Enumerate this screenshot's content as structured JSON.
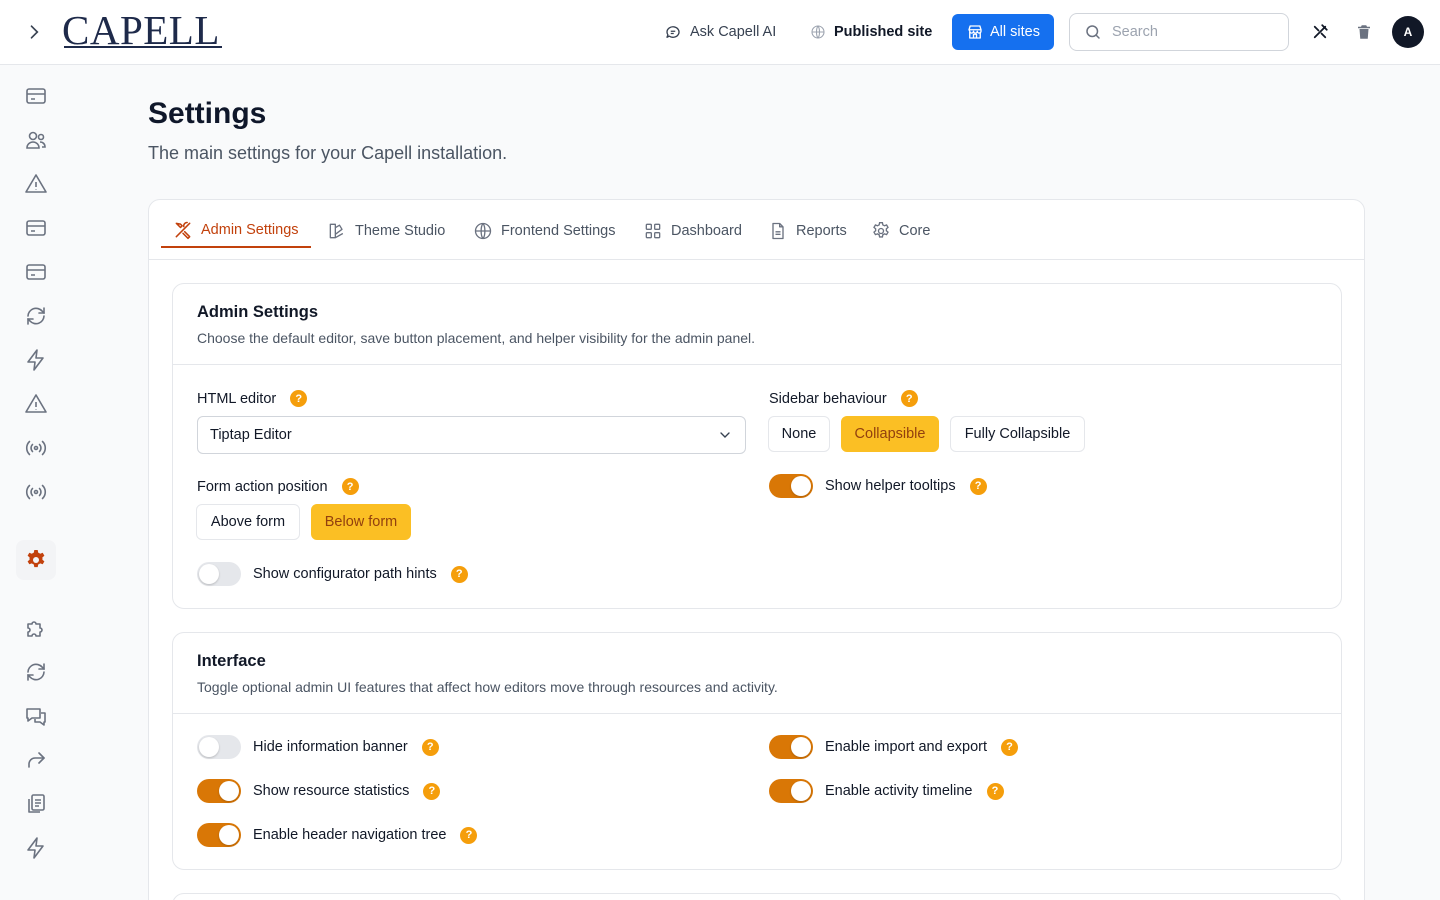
{
  "brand": {
    "logo": "CAPELL"
  },
  "header": {
    "ask_ai": "Ask Capell AI",
    "published_site": "Published site",
    "all_sites": "All sites",
    "search_placeholder": "Search",
    "avatar_initial": "A"
  },
  "colors": {
    "primary": "#1570ef",
    "accent": "#d97706",
    "active_tab": "#c2410c",
    "selected_segment": "#fbbf24",
    "help": "#f59e0b"
  },
  "page": {
    "title": "Settings",
    "subtitle": "The main settings for your Capell installation."
  },
  "tabs": [
    {
      "label": "Admin Settings",
      "icon": "tools-icon",
      "active": true
    },
    {
      "label": "Theme Studio",
      "icon": "palette-icon"
    },
    {
      "label": "Frontend Settings",
      "icon": "globe-icon"
    },
    {
      "label": "Dashboard",
      "icon": "grid-icon"
    },
    {
      "label": "Reports",
      "icon": "file-icon"
    },
    {
      "label": "Core",
      "icon": "gear-icon"
    }
  ],
  "admin": {
    "title": "Admin Settings",
    "description": "Choose the default editor, save button placement, and helper visibility for the admin panel.",
    "html_editor_label": "HTML editor",
    "html_editor_value": "Tiptap Editor",
    "sidebar_label": "Sidebar behaviour",
    "sidebar_options": [
      "None",
      "Collapsible",
      "Fully Collapsible"
    ],
    "sidebar_selected": "Collapsible",
    "form_action_label": "Form action position",
    "form_action_options": [
      "Above form",
      "Below form"
    ],
    "form_action_selected": "Below form",
    "helper_tooltips_label": "Show helper tooltips",
    "helper_tooltips_on": true,
    "path_hints_label": "Show configurator path hints",
    "path_hints_on": false
  },
  "interface": {
    "title": "Interface",
    "description": "Toggle optional admin UI features that affect how editors move through resources and activity.",
    "toggles": [
      {
        "label": "Hide information banner",
        "on": false
      },
      {
        "label": "Enable import and export",
        "on": true
      },
      {
        "label": "Show resource statistics",
        "on": true
      },
      {
        "label": "Enable activity timeline",
        "on": true
      },
      {
        "label": "Enable header navigation tree",
        "on": true
      }
    ]
  },
  "sidebar_icons": [
    "card-icon",
    "users-icon",
    "alert-icon",
    "card-icon",
    "card-icon",
    "refresh-icon",
    "bolt-icon",
    "alert-icon",
    "broadcast-icon",
    "broadcast-icon",
    "gear-icon",
    "puzzle-icon",
    "refresh-icon",
    "chat-icon",
    "share-icon",
    "copy-icon",
    "bolt-icon"
  ]
}
